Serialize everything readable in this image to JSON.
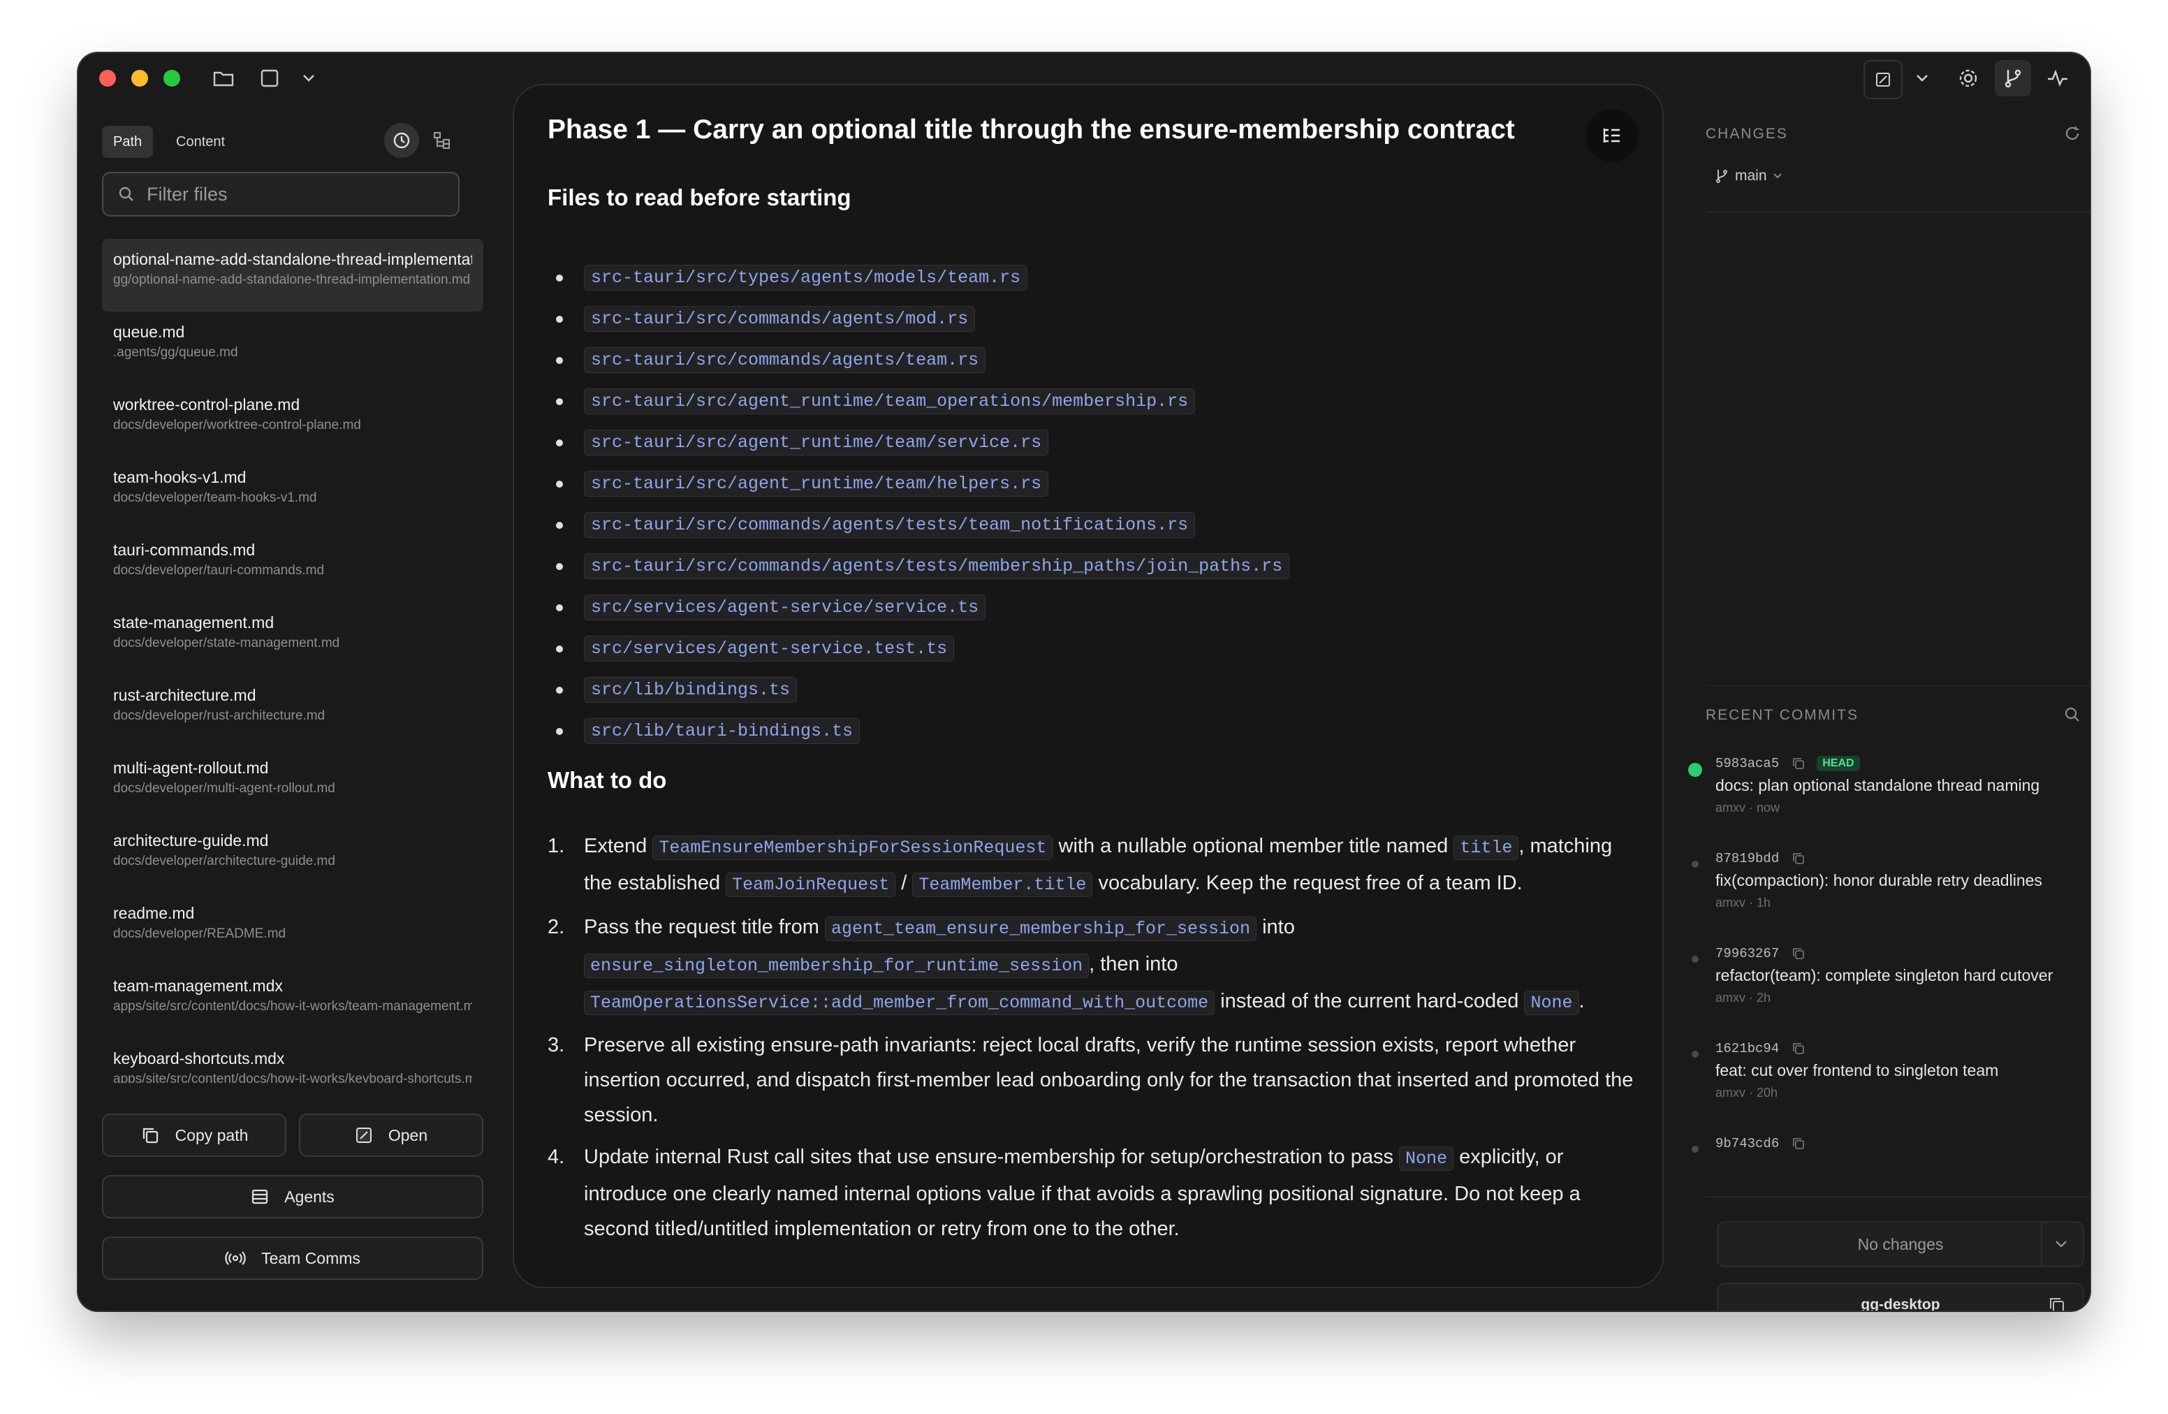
{
  "sidebar": {
    "tabs": [
      "Path",
      "Content"
    ],
    "filter_placeholder": "Filter files",
    "files": [
      {
        "name": "optional-name-add-standalone-thread-implementation.md",
        "path": "gg/optional-name-add-standalone-thread-implementation.md",
        "active": true
      },
      {
        "name": "queue.md",
        "path": ".agents/gg/queue.md"
      },
      {
        "name": "worktree-control-plane.md",
        "path": "docs/developer/worktree-control-plane.md"
      },
      {
        "name": "team-hooks-v1.md",
        "path": "docs/developer/team-hooks-v1.md"
      },
      {
        "name": "tauri-commands.md",
        "path": "docs/developer/tauri-commands.md"
      },
      {
        "name": "state-management.md",
        "path": "docs/developer/state-management.md"
      },
      {
        "name": "rust-architecture.md",
        "path": "docs/developer/rust-architecture.md"
      },
      {
        "name": "multi-agent-rollout.md",
        "path": "docs/developer/multi-agent-rollout.md"
      },
      {
        "name": "architecture-guide.md",
        "path": "docs/developer/architecture-guide.md"
      },
      {
        "name": "readme.md",
        "path": "docs/developer/README.md"
      },
      {
        "name": "team-management.mdx",
        "path": "apps/site/src/content/docs/how-it-works/team-management.mdx"
      },
      {
        "name": "keyboard-shortcuts.mdx",
        "path": "apps/site/src/content/docs/how-it-works/keyboard-shortcuts.mdx"
      }
    ],
    "buttons": {
      "copy_path": "Copy path",
      "open": "Open",
      "agents": "Agents",
      "team_comms": "Team Comms"
    }
  },
  "main": {
    "title": "Phase 1 — Carry an optional title through the ensure-membership contract",
    "files_heading": "Files to read before starting",
    "files": [
      "src-tauri/src/types/agents/models/team.rs",
      "src-tauri/src/commands/agents/mod.rs",
      "src-tauri/src/commands/agents/team.rs",
      "src-tauri/src/agent_runtime/team_operations/membership.rs",
      "src-tauri/src/agent_runtime/team/service.rs",
      "src-tauri/src/agent_runtime/team/helpers.rs",
      "src-tauri/src/commands/agents/tests/team_notifications.rs",
      "src-tauri/src/commands/agents/tests/membership_paths/join_paths.rs",
      "src/services/agent-service/service.ts",
      "src/services/agent-service.test.ts",
      "src/lib/bindings.ts",
      "src/lib/tauri-bindings.ts"
    ],
    "todo_heading": "What to do",
    "steps": [
      {
        "num": "1.",
        "parts": [
          {
            "t": "Extend "
          },
          {
            "c": "TeamEnsureMembershipForSessionRequest"
          },
          {
            "t": " with a nullable optional member title named "
          },
          {
            "c": "title"
          },
          {
            "t": ", matching the established "
          },
          {
            "c": "TeamJoinRequest"
          },
          {
            "t": " / "
          },
          {
            "c": "TeamMember.title"
          },
          {
            "t": " vocabulary. Keep the request free of a team ID."
          }
        ]
      },
      {
        "num": "2.",
        "parts": [
          {
            "t": "Pass the request title from "
          },
          {
            "c": "agent_team_ensure_membership_for_session"
          },
          {
            "t": " into "
          },
          {
            "c": "ensure_singleton_membership_for_runtime_session"
          },
          {
            "t": ", then into "
          },
          {
            "c": "TeamOperationsService::add_member_from_command_with_outcome"
          },
          {
            "t": " instead of the current hard-coded "
          },
          {
            "c": "None"
          },
          {
            "t": "."
          }
        ]
      },
      {
        "num": "3.",
        "parts": [
          {
            "t": "Preserve all existing ensure-path invariants: reject local drafts, verify the runtime session exists, report whether insertion occurred, and dispatch first-member lead onboarding only for the transaction that inserted and promoted the session."
          }
        ]
      },
      {
        "num": "4.",
        "parts": [
          {
            "t": "Update internal Rust call sites that use ensure-membership for setup/orchestration to pass "
          },
          {
            "c": "None"
          },
          {
            "t": " explicitly, or introduce one clearly named internal options value if that avoids a sprawling positional signature. Do not keep a second titled/untitled implementation or retry from one to the other."
          }
        ]
      }
    ]
  },
  "right": {
    "changes_label": "CHANGES",
    "branch": "main",
    "commits_label": "RECENT COMMITS",
    "commits": [
      {
        "hash": "5983aca5",
        "head": "HEAD",
        "msg": "docs: plan optional standalone thread naming",
        "author": "amxv",
        "time": "now"
      },
      {
        "hash": "87819bdd",
        "msg": "fix(compaction): honor durable retry deadlines",
        "author": "amxv",
        "time": "1h"
      },
      {
        "hash": "79963267",
        "msg": "refactor(team): complete singleton hard cutover",
        "author": "amxv",
        "time": "2h"
      },
      {
        "hash": "1621bc94",
        "msg": "feat: cut over frontend to singleton team",
        "author": "amxv",
        "time": "20h"
      },
      {
        "hash": "9b743cd6",
        "msg": "",
        "author": "",
        "time": ""
      }
    ],
    "no_changes": "No changes",
    "workspace": "gg-desktop"
  },
  "colors": {
    "accent_code": "#8fa6e8",
    "head_badge": "#4fe08e",
    "active_dot": "#2ecc71"
  }
}
